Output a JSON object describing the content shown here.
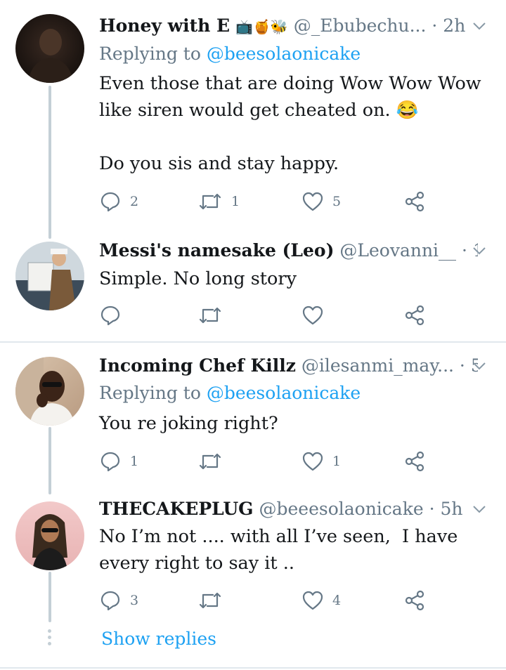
{
  "tweets": [
    {
      "name": "Honey with E",
      "name_emojis": "📺🍯🐝",
      "handle": "@_Ebubechu...",
      "time": "2h",
      "reply_label": "Replying to",
      "reply_to": "@beesolaonicake",
      "text": "Even those that are doing Wow Wow Wow like siren would get cheated on. 😂\n\nDo you sis and stay happy.",
      "replies": "2",
      "retweets": "1",
      "likes": "5"
    },
    {
      "name": "Messi's namesake (Leo)",
      "handle": "@Leovanni__",
      "time": "1h",
      "text": "Simple. No long story",
      "replies": "",
      "retweets": "",
      "likes": ""
    },
    {
      "name": "Incoming Chef Killz",
      "handle": "@ilesanmi_may...",
      "time": "5h",
      "reply_label": "Replying to",
      "reply_to": "@beesolaonicake",
      "text": "You re joking right?",
      "replies": "1",
      "retweets": "",
      "likes": "1"
    },
    {
      "name": "THECAKEPLUG",
      "handle": "@beeesolaonicake",
      "time": "5h",
      "text": "No I’m not .... with all I’ve seen,  I have every right to say it ..",
      "replies": "3",
      "retweets": "",
      "likes": "4"
    }
  ],
  "separator": "·",
  "show_replies_label": "Show replies",
  "colors": {
    "text": "#14171a",
    "muted": "#657786",
    "accent": "#1da1f2",
    "thread_line": "#c4cfd6",
    "divider": "#e1e8ed"
  },
  "icons": [
    "reply-icon",
    "retweet-icon",
    "like-icon",
    "share-icon",
    "chevron-down-icon"
  ]
}
